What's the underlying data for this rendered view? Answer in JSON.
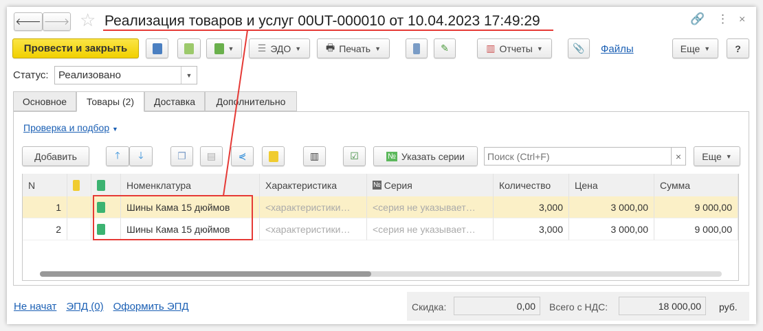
{
  "window": {
    "title": "Реализация товаров и услуг 00UT-000010 от 10.04.2023 17:49:29",
    "back_icon": "arrow-left-icon",
    "forward_icon": "arrow-right-icon"
  },
  "toolbar": {
    "post_close": "Провести и закрыть",
    "edo": "ЭДО",
    "print": "Печать",
    "reports": "Отчеты",
    "files": "Файлы",
    "more": "Еще",
    "help": "?"
  },
  "status": {
    "label": "Статус:",
    "value": "Реализовано"
  },
  "tabs": [
    {
      "label": "Основное"
    },
    {
      "label": "Товары (2)"
    },
    {
      "label": "Доставка"
    },
    {
      "label": "Дополнительно"
    }
  ],
  "goods": {
    "check_link": "Проверка и подбор",
    "add": "Добавить",
    "series": "Указать серии",
    "series_badge": "№",
    "search_placeholder": "Поиск (Ctrl+F)",
    "clear": "×",
    "more": "Еще",
    "columns": [
      "N",
      "Номенклатура",
      "Характеристика",
      "Серия",
      "Количество",
      "Цена",
      "Сумма"
    ],
    "rows": [
      {
        "n": "1",
        "item": "Шины Кама 15 дюймов",
        "char": "<характеристики…",
        "series": "<серия не указывает…",
        "qty": "3,000",
        "price": "3 000,00",
        "sum": "9 000,00"
      },
      {
        "n": "2",
        "item": "Шины Кама 15 дюймов",
        "char": "<характеристики…",
        "series": "<серия не указывает…",
        "qty": "3,000",
        "price": "3 000,00",
        "sum": "9 000,00"
      }
    ]
  },
  "footer": {
    "links": [
      "Не начат",
      "ЭПД (0)",
      "Оформить ЭПД"
    ],
    "discount_label": "Скидка:",
    "discount": "0,00",
    "total_label": "Всего с НДС:",
    "total": "18 000,00",
    "currency": "руб."
  },
  "colors": {
    "accent_button": "#f5d90a",
    "selected_row": "#fbf0c7",
    "annotation": "#e53935",
    "link": "#1a5fb4"
  }
}
